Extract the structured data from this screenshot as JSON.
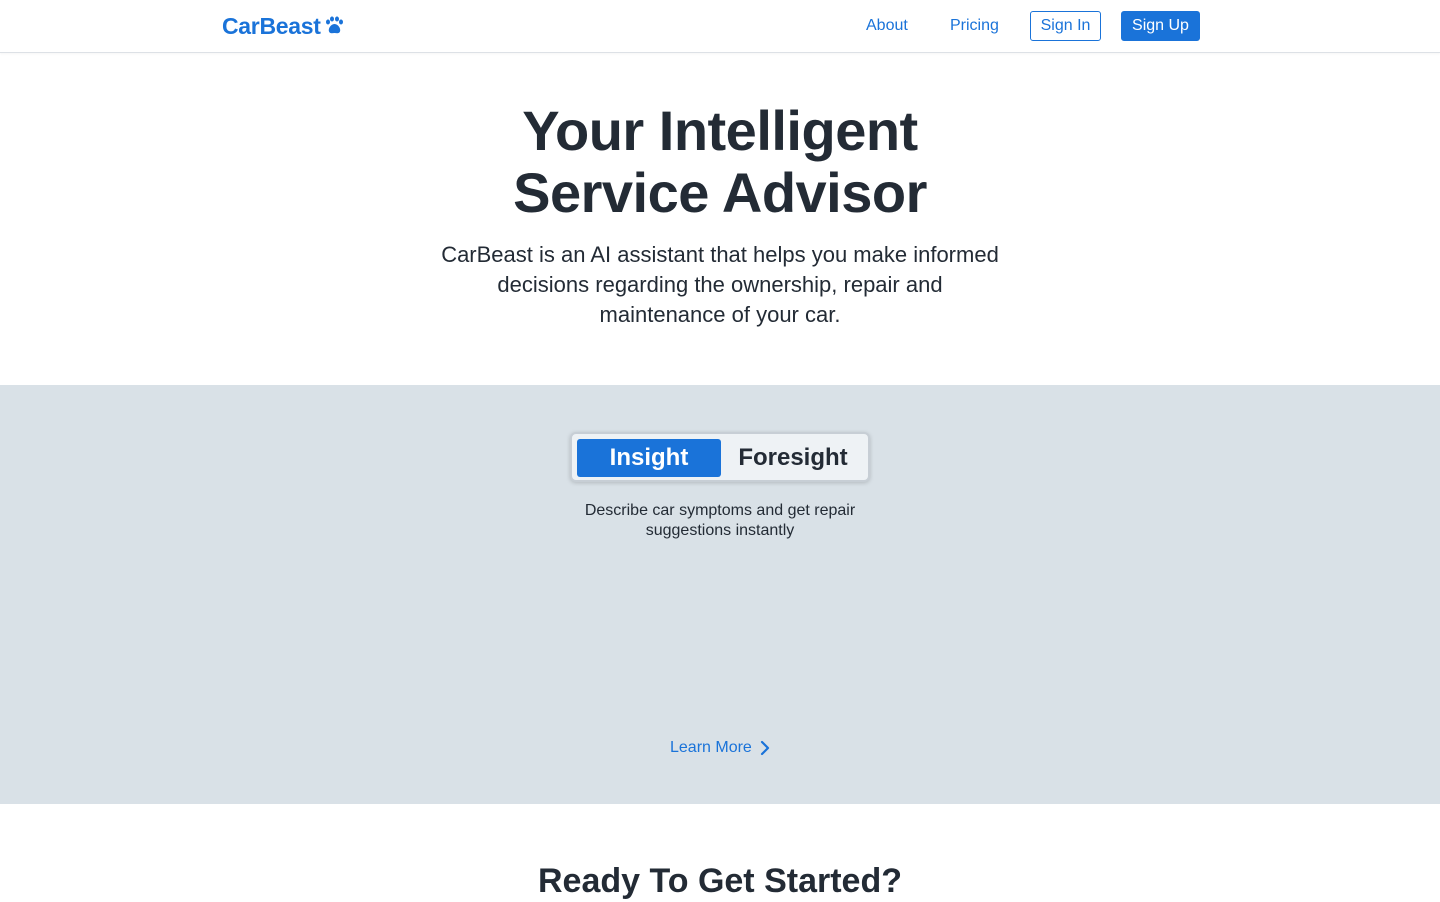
{
  "nav": {
    "brand": "CarBeast",
    "brand_icon": "paw-icon",
    "about": "About",
    "pricing": "Pricing",
    "sign_in": "Sign In",
    "sign_up": "Sign Up"
  },
  "hero": {
    "title_line1": "Your Intelligent",
    "title_line2": "Service Advisor",
    "subtitle": "CarBeast is an AI assistant that helps you make informed decisions regarding the ownership, repair and maintenance of your car."
  },
  "feature": {
    "tabs": [
      {
        "label": "Insight",
        "active": true
      },
      {
        "label": "Foresight",
        "active": false
      }
    ],
    "description": "Describe car symptoms and get repair suggestions instantly",
    "learn_more": "Learn More",
    "learn_more_icon": "chevron-right-icon"
  },
  "cta": {
    "title": "Ready To Get Started?"
  },
  "colors": {
    "accent": "#1a73d9",
    "text": "#232b35",
    "band": "#d9e1e7"
  }
}
